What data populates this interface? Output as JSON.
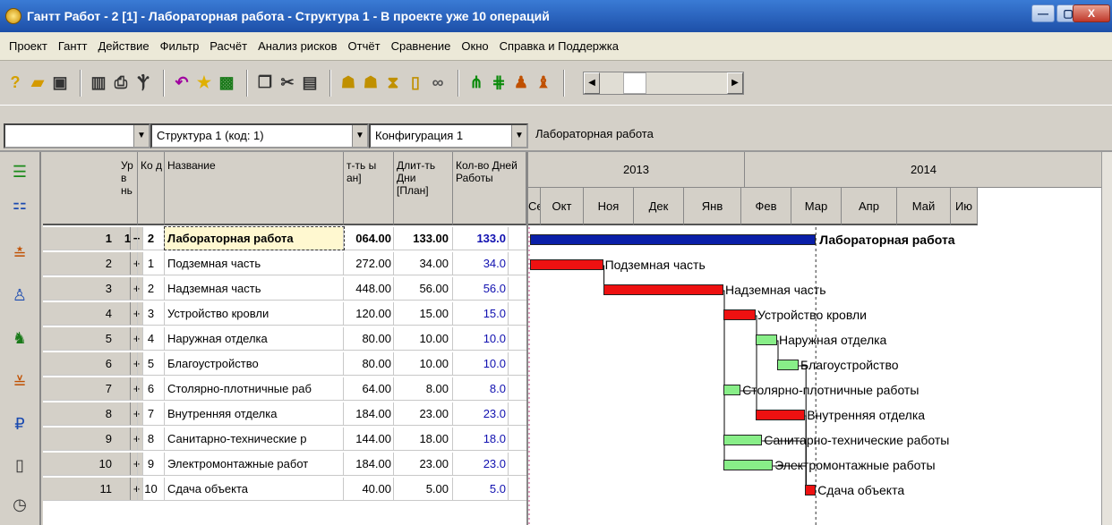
{
  "window": {
    "title": "Гантт Работ - 2 [1] - Лабораторная работа - Структура 1 - В проекте уже 10 операций"
  },
  "menu": [
    "Проект",
    "Гантт",
    "Действие",
    "Фильтр",
    "Расчёт",
    "Анализ рисков",
    "Отчёт",
    "Сравнение",
    "Окно",
    "Справка и Поддержка"
  ],
  "selectors": {
    "first": "",
    "structure": "Структура 1 (код: 1)",
    "configuration": "Конфигурация 1",
    "project_name": "Лабораторная работа"
  },
  "grid": {
    "headers": {
      "lvl": "Ур в нь",
      "code": "Ко д",
      "name": "Название",
      "cost": "т-ть ы ан]",
      "duration": "Длит-ть Дни [План]",
      "days": "Кол-во Дней Работы"
    },
    "rows": [
      {
        "num": "1",
        "exp": "−",
        "lvl": "1",
        "code": "2",
        "name": "Лабораторная работа",
        "cost": "064.00",
        "duration": "133.00",
        "days": "133.0",
        "summary": true
      },
      {
        "num": "2",
        "exp": "+",
        "lvl": "",
        "code": "1",
        "name": "Подземная часть",
        "cost": "272.00",
        "duration": "34.00",
        "days": "34.0"
      },
      {
        "num": "3",
        "exp": "+",
        "lvl": "",
        "code": "2",
        "name": "Надземная часть",
        "cost": "448.00",
        "duration": "56.00",
        "days": "56.0"
      },
      {
        "num": "4",
        "exp": "+",
        "lvl": "",
        "code": "3",
        "name": "Устройство кровли",
        "cost": "120.00",
        "duration": "15.00",
        "days": "15.0"
      },
      {
        "num": "5",
        "exp": "+",
        "lvl": "",
        "code": "4",
        "name": "Наружная отделка",
        "cost": "80.00",
        "duration": "10.00",
        "days": "10.0"
      },
      {
        "num": "6",
        "exp": "+",
        "lvl": "",
        "code": "5",
        "name": "Благоустройство",
        "cost": "80.00",
        "duration": "10.00",
        "days": "10.0"
      },
      {
        "num": "7",
        "exp": "+",
        "lvl": "",
        "code": "6",
        "name": "Столярно-плотничные раб",
        "cost": "64.00",
        "duration": "8.00",
        "days": "8.0"
      },
      {
        "num": "8",
        "exp": "+",
        "lvl": "",
        "code": "7",
        "name": "Внутренняя отделка",
        "cost": "184.00",
        "duration": "23.00",
        "days": "23.0"
      },
      {
        "num": "9",
        "exp": "+",
        "lvl": "",
        "code": "8",
        "name": "Санитарно-технические р",
        "cost": "144.00",
        "duration": "18.00",
        "days": "18.0"
      },
      {
        "num": "10",
        "exp": "+",
        "lvl": "",
        "code": "9",
        "name": "Электромонтажные работ",
        "cost": "184.00",
        "duration": "23.00",
        "days": "23.0"
      },
      {
        "num": "11",
        "exp": "+",
        "lvl": "",
        "code": "10",
        "name": "Сдача объекта",
        "cost": "40.00",
        "duration": "5.00",
        "days": "5.0"
      }
    ]
  },
  "gantt": {
    "years": [
      "2013",
      "2014"
    ],
    "months": [
      "Се",
      "Окт",
      "Ноя",
      "Дек",
      "Янв",
      "Фев",
      "Мар",
      "Апр",
      "Май",
      "Ию"
    ],
    "summary_label": "Лабораторная работа",
    "colors": {
      "summary": "#0a1fa8",
      "critical": "#ee1111",
      "normal": "#88ee88",
      "link": "#000000"
    },
    "tasks": [
      {
        "label": "Подземная часть",
        "start": 0,
        "dur": 34,
        "critical": true
      },
      {
        "label": "Надземная часть",
        "start": 34,
        "dur": 56,
        "critical": true
      },
      {
        "label": "Устройство кровли",
        "start": 90,
        "dur": 15,
        "critical": true
      },
      {
        "label": "Наружная отделка",
        "start": 105,
        "dur": 10,
        "critical": false
      },
      {
        "label": "Благоустройство",
        "start": 115,
        "dur": 10,
        "critical": false
      },
      {
        "label": "Столярно-плотничные работы",
        "start": 90,
        "dur": 8,
        "critical": false
      },
      {
        "label": "Внутренняя отделка",
        "start": 105,
        "dur": 23,
        "critical": true
      },
      {
        "label": "Санитарно-технические работы",
        "start": 90,
        "dur": 18,
        "critical": false
      },
      {
        "label": "Электромонтажные работы",
        "start": 90,
        "dur": 23,
        "critical": false
      },
      {
        "label": "Сдача объекта",
        "start": 128,
        "dur": 5,
        "critical": true
      }
    ],
    "summary": {
      "start": 0,
      "dur": 133
    }
  }
}
